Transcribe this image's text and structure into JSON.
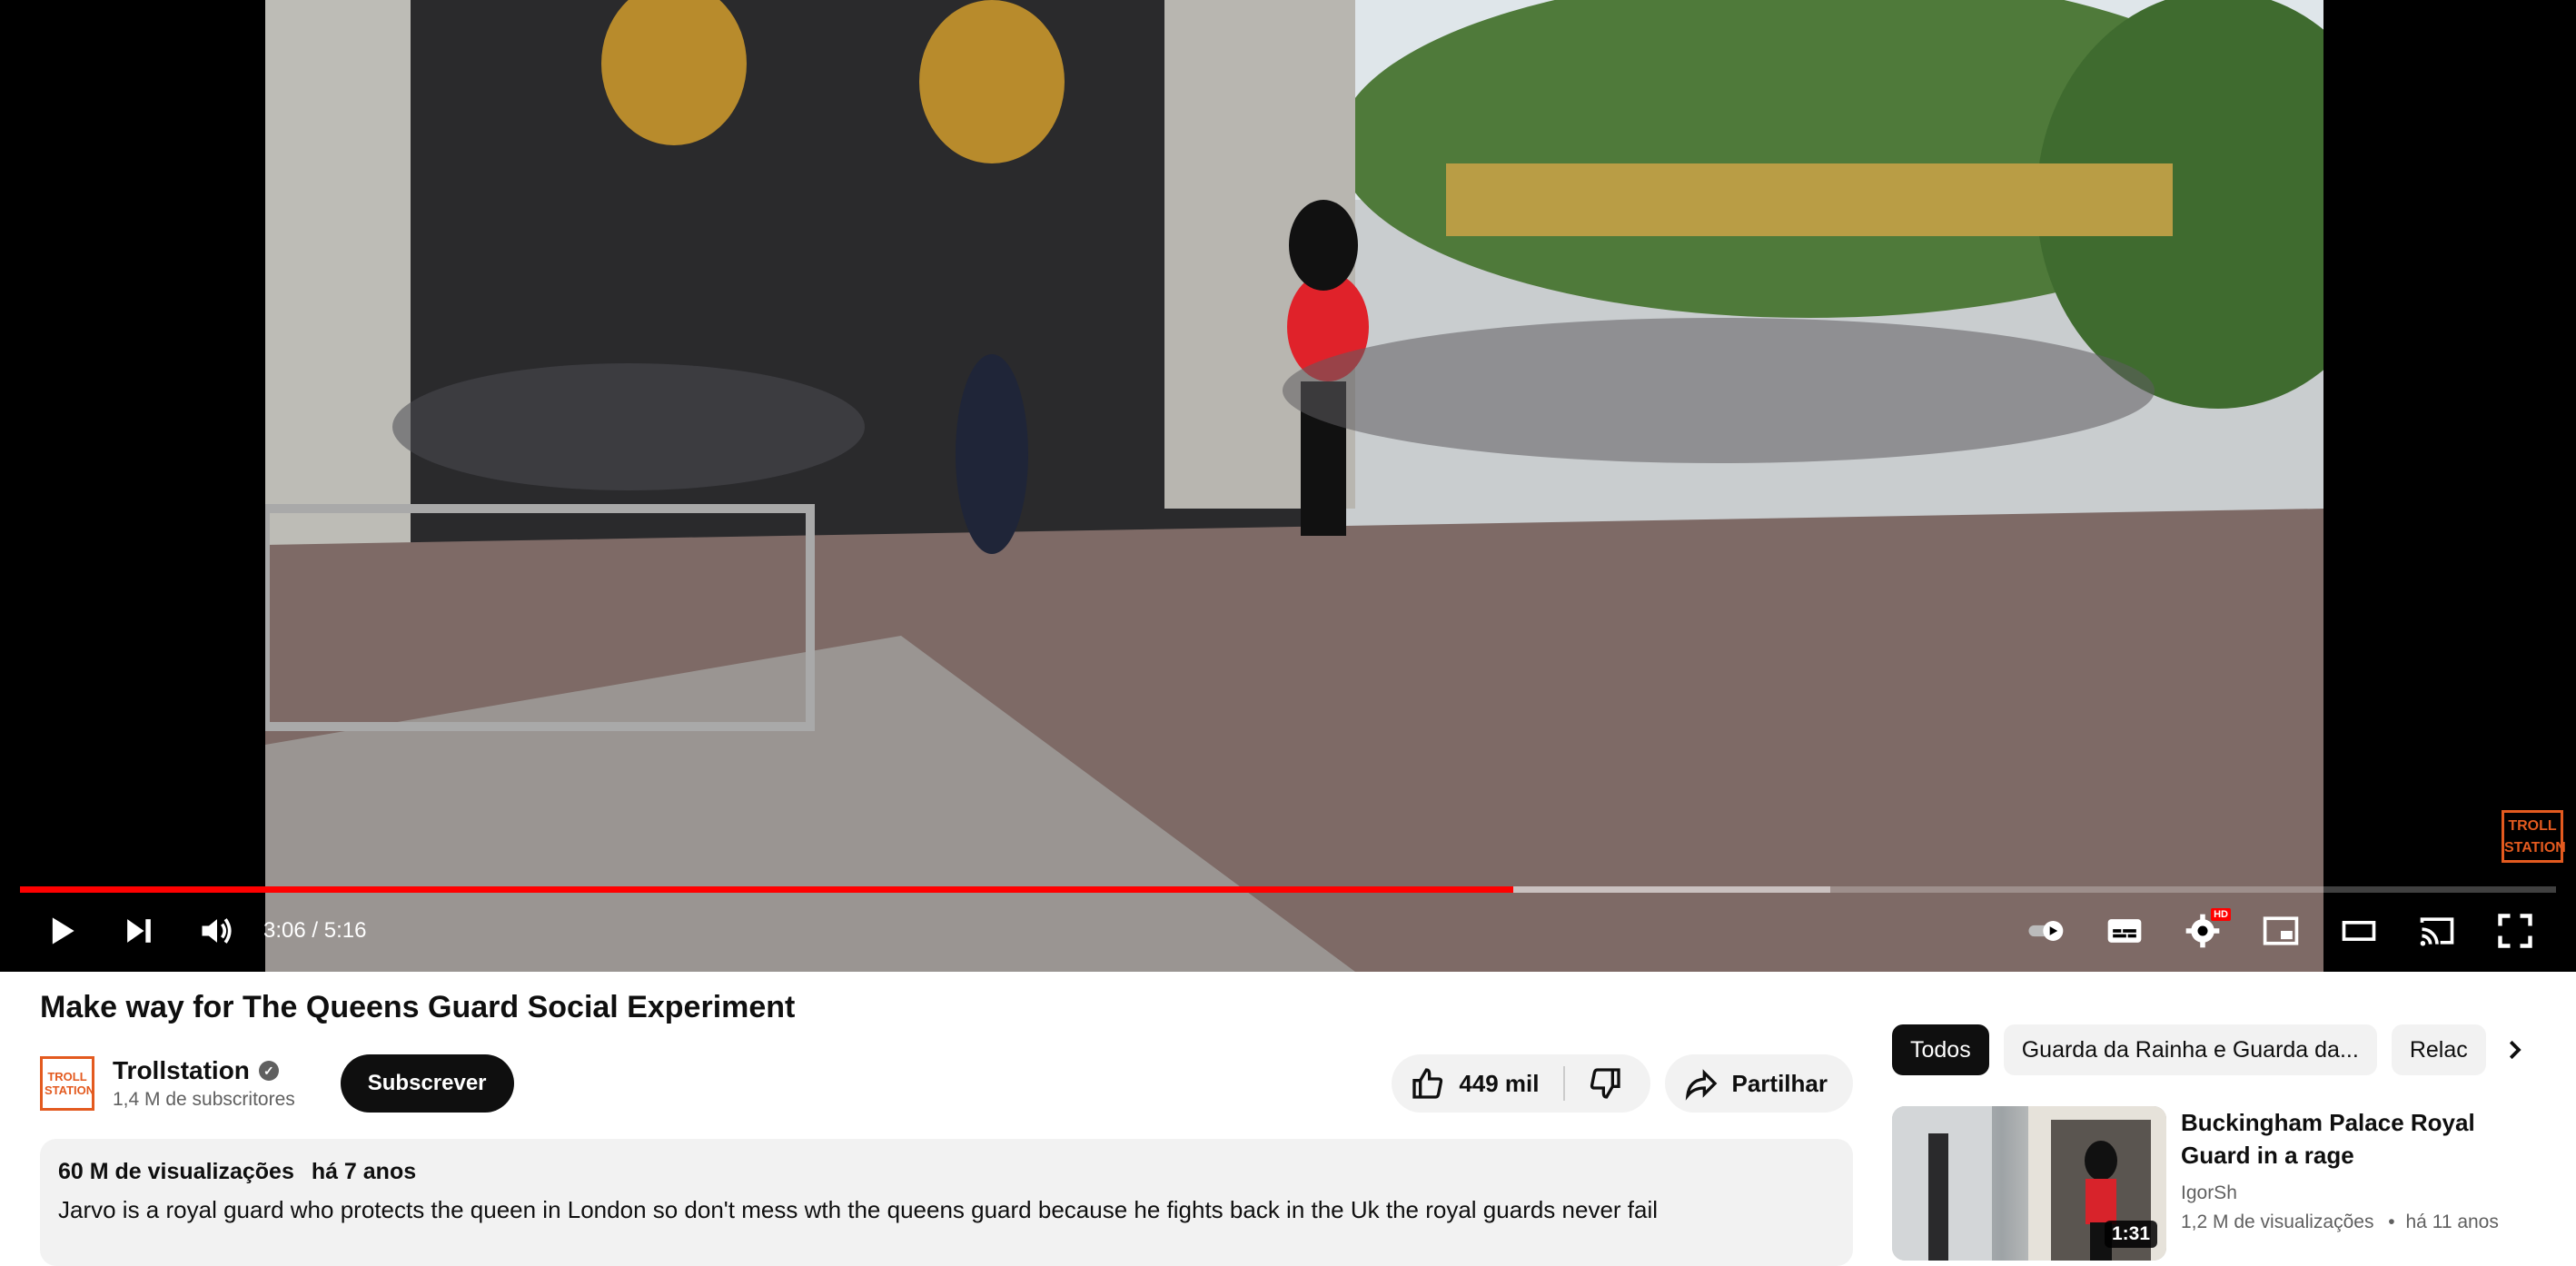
{
  "player": {
    "time_current": "3:06",
    "time_total": "5:16",
    "time_display": "3:06 / 5:16",
    "progress_fraction": 0.589,
    "buffered_fraction": 0.714,
    "watermark": "TROLL STATION",
    "hd_badge": "HD",
    "accent_color": "#ff0000",
    "controls_left": [
      "play-icon",
      "next-icon",
      "volume-icon"
    ],
    "controls_right": [
      "autoplay-toggle-icon",
      "subtitles-icon",
      "settings-icon",
      "miniplayer-icon",
      "theater-icon",
      "cast-icon",
      "fullscreen-icon"
    ]
  },
  "video": {
    "title": "Make way for The Queens Guard Social Experiment",
    "channel": "Trollstation",
    "channel_avatar_text": "TROLL STATION",
    "subscribers": "1,4 M de subscritores",
    "subscribe_label": "Subscrever",
    "likes": "449 mil",
    "share_label": "Partilhar",
    "views": "60 M de visualizações",
    "age": "há 7 anos",
    "description": "Jarvo is a royal guard who protects the queen in London so don't mess wth the queens guard because he fights back in the Uk the royal guards never fail"
  },
  "sidebar": {
    "chips": [
      "Todos",
      "Guarda da Rainha e Guarda da...",
      "Relac"
    ],
    "recommendations": [
      {
        "title": "Buckingham Palace Royal Guard in a rage",
        "channel": "IgorSh",
        "views": "1,2 M de visualizações",
        "age": "há 11 anos",
        "stats_separator": "•",
        "duration": "1:31"
      }
    ]
  }
}
